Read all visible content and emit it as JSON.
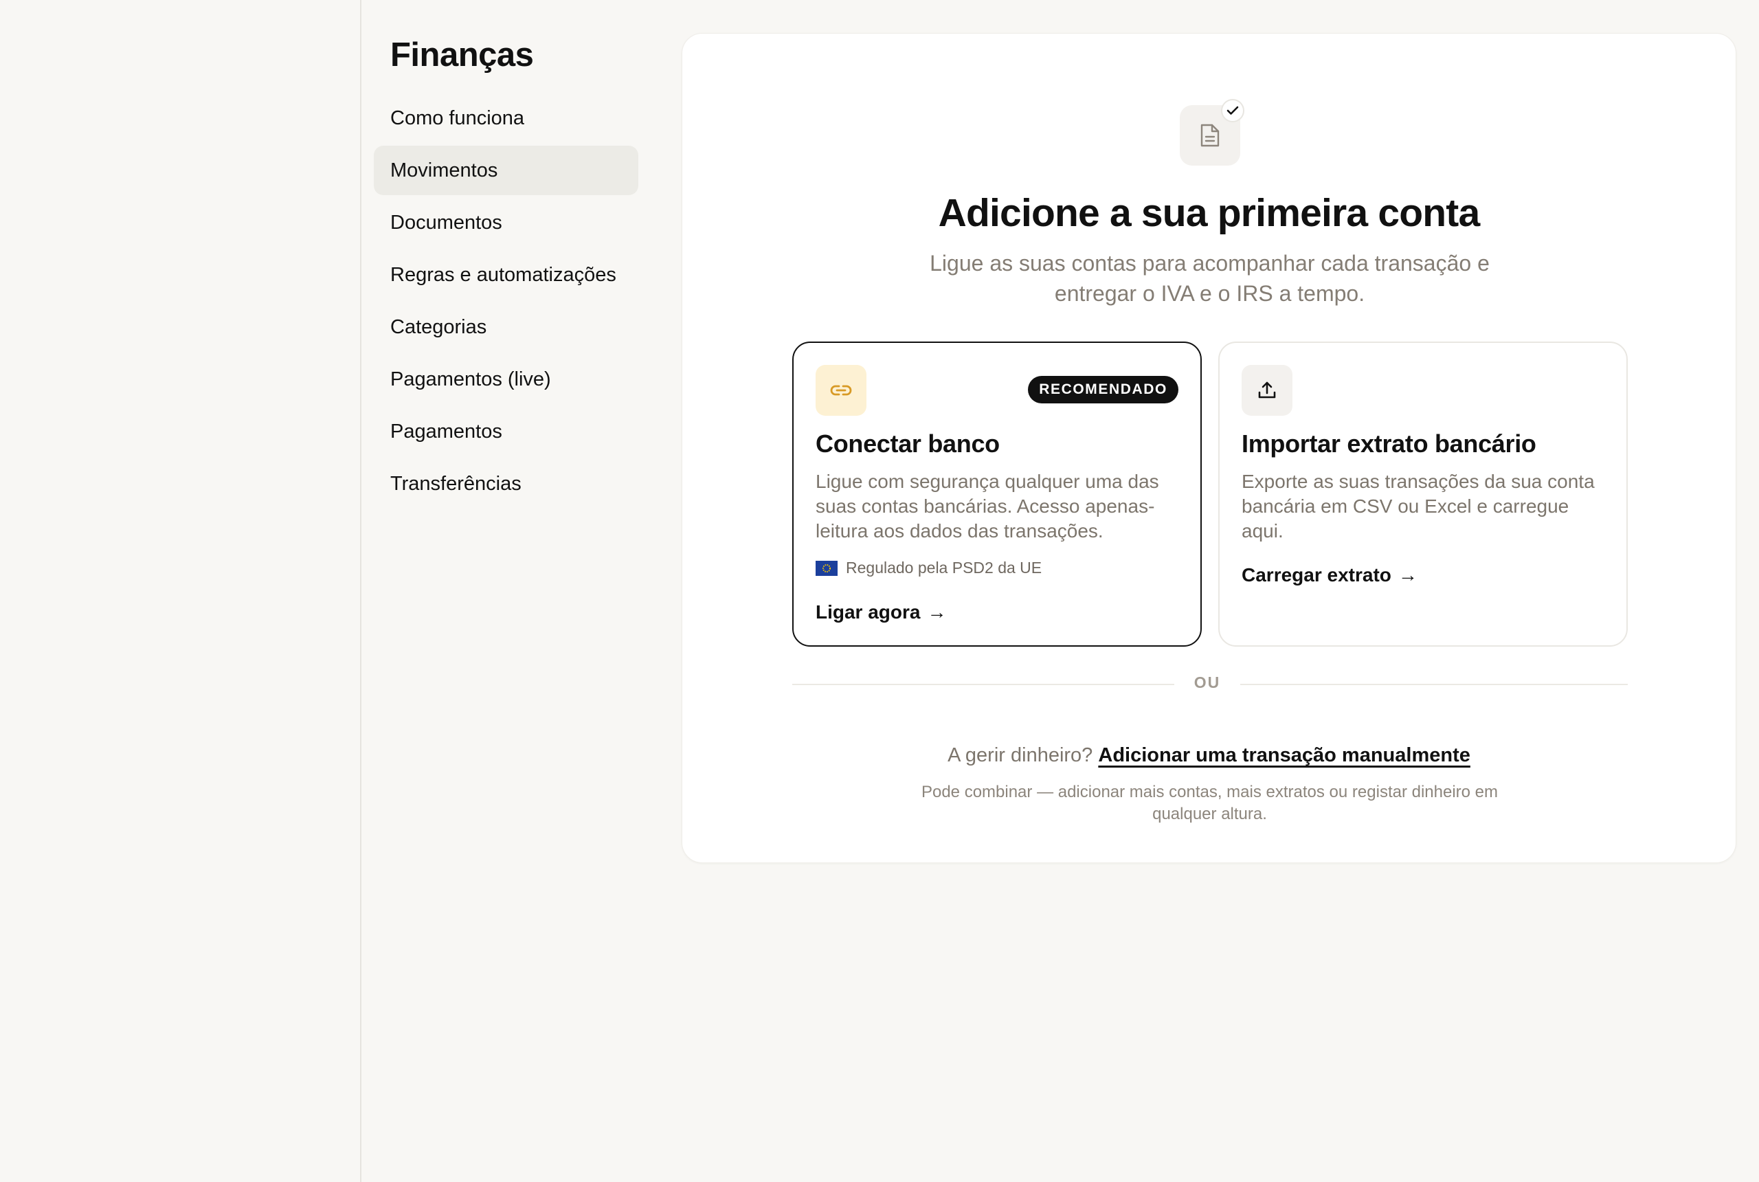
{
  "sidebar": {
    "title": "Finanças",
    "items": [
      {
        "label": "Como funciona",
        "active": false
      },
      {
        "label": "Movimentos",
        "active": true
      },
      {
        "label": "Documentos",
        "active": false
      },
      {
        "label": "Regras e automatizações",
        "active": false
      },
      {
        "label": "Categorias",
        "active": false
      },
      {
        "label": "Pagamentos (live)",
        "active": false
      },
      {
        "label": "Pagamentos",
        "active": false
      },
      {
        "label": "Transferências",
        "active": false
      }
    ]
  },
  "empty_state": {
    "icon": "document-check-icon",
    "title": "Adicione a sua primeira conta",
    "subtitle": "Ligue as suas contas para acompanhar cada transação e entregar o IVA e o IRS a tempo.",
    "options": {
      "connect": {
        "icon": "link-icon",
        "badge": "RECOMENDADO",
        "title": "Conectar banco",
        "description": "Ligue com segurança qualquer uma das suas contas bancárias. Acesso apenas-leitura aos dados das transações.",
        "regulation": "Regulado pela PSD2 da UE",
        "cta": "Ligar agora",
        "accent_bg": "#fdf1d3",
        "accent_icon": "#d89a25"
      },
      "import": {
        "icon": "upload-icon",
        "title": "Importar extrato bancário",
        "description": "Exporte as suas transações da sua conta bancária em CSV ou Excel e carregue aqui.",
        "cta": "Carregar extrato"
      }
    },
    "divider_label": "OU",
    "manual_prompt": "A gerir dinheiro?",
    "manual_link": "Adicionar uma transação manualmente",
    "footnote": "Pode combinar — adicionar mais contas, mais extratos ou registar dinheiro em qualquer altura."
  }
}
